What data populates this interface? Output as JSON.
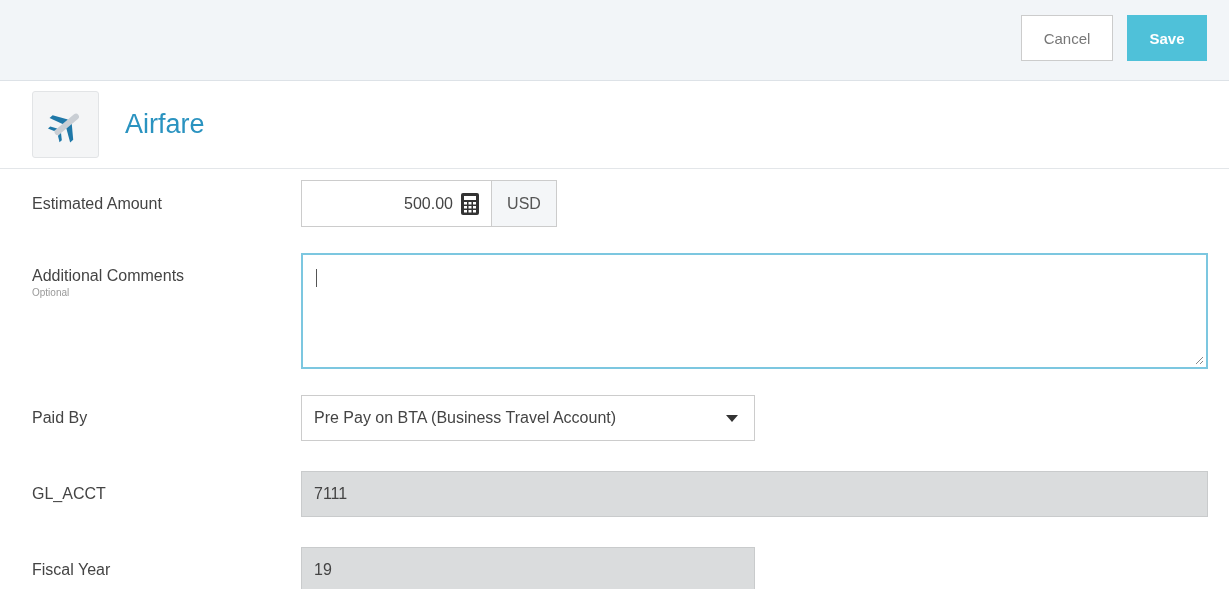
{
  "toolbar": {
    "buttons": [
      {
        "label": "Cancel",
        "kind": "secondary"
      },
      {
        "label": "Save",
        "kind": "primary"
      }
    ]
  },
  "header": {
    "title": "Airfare"
  },
  "fields": [
    {
      "kind": "amount",
      "label": "Estimated Amount",
      "value": "500.00",
      "currency": "USD"
    },
    {
      "kind": "textarea",
      "label": "Additional Comments",
      "hint": "Optional",
      "focused": true
    },
    {
      "kind": "select",
      "label": "Paid By",
      "value": "Pre Pay on BTA (Business Travel Account)"
    },
    {
      "kind": "readonly",
      "label": "GL_ACCT",
      "value": "7111",
      "wide": true
    },
    {
      "kind": "readonly",
      "label": "Fiscal Year",
      "value": "19",
      "wide": false
    }
  ]
}
